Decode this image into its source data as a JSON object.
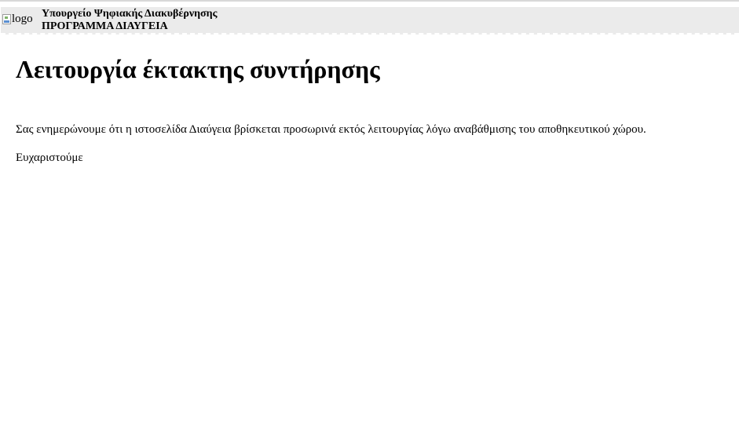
{
  "header": {
    "logo_alt": "logo",
    "ministry": "Υπουργείο Ψηφιακής Διακυβέρνησης",
    "program": "ΠΡΟΓΡΑΜΜΑ ΔΙΑΥΓΕΙΑ"
  },
  "main": {
    "title": "Λειτουργία έκτακτης συντήρησης",
    "notice": "Σας ενημερώνουμε ότι η ιστοσελίδα Διαύγεια βρίσκεται προσωρινά εκτός λειτουργίας λόγω αναβάθμισης του αποθηκευτικού χώρου.",
    "thanks": "Ευχαριστούμε"
  }
}
